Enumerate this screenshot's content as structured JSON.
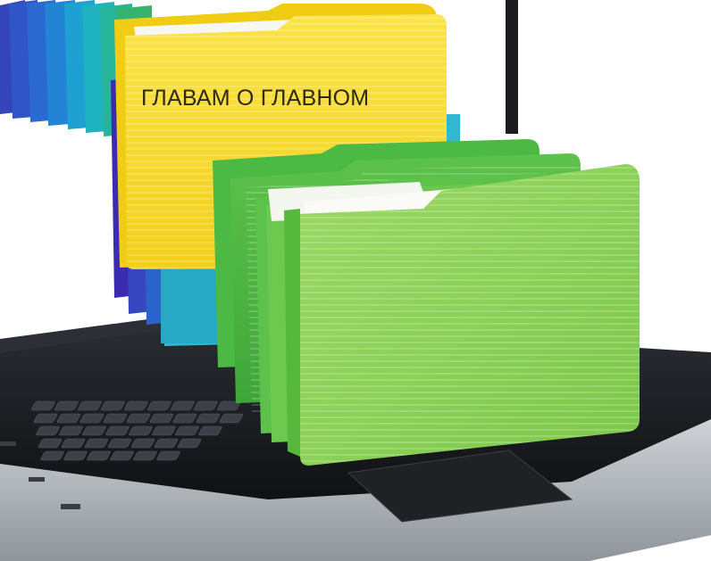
{
  "headline": "ГЛАВАМ О ГЛАВНОМ",
  "icons": [
    "laptop-icon",
    "folder-icon"
  ],
  "colors": {
    "folder_yellow": "#f7dc2e",
    "folder_green": "#72c948",
    "folder_light_green": "#8fd25a",
    "folder_teal": "#2fb8d0",
    "folder_blue": "#3a57c4",
    "laptop_dark": "#1b1d21",
    "laptop_silver": "#c4c8cc",
    "text": "#2d2a12"
  }
}
